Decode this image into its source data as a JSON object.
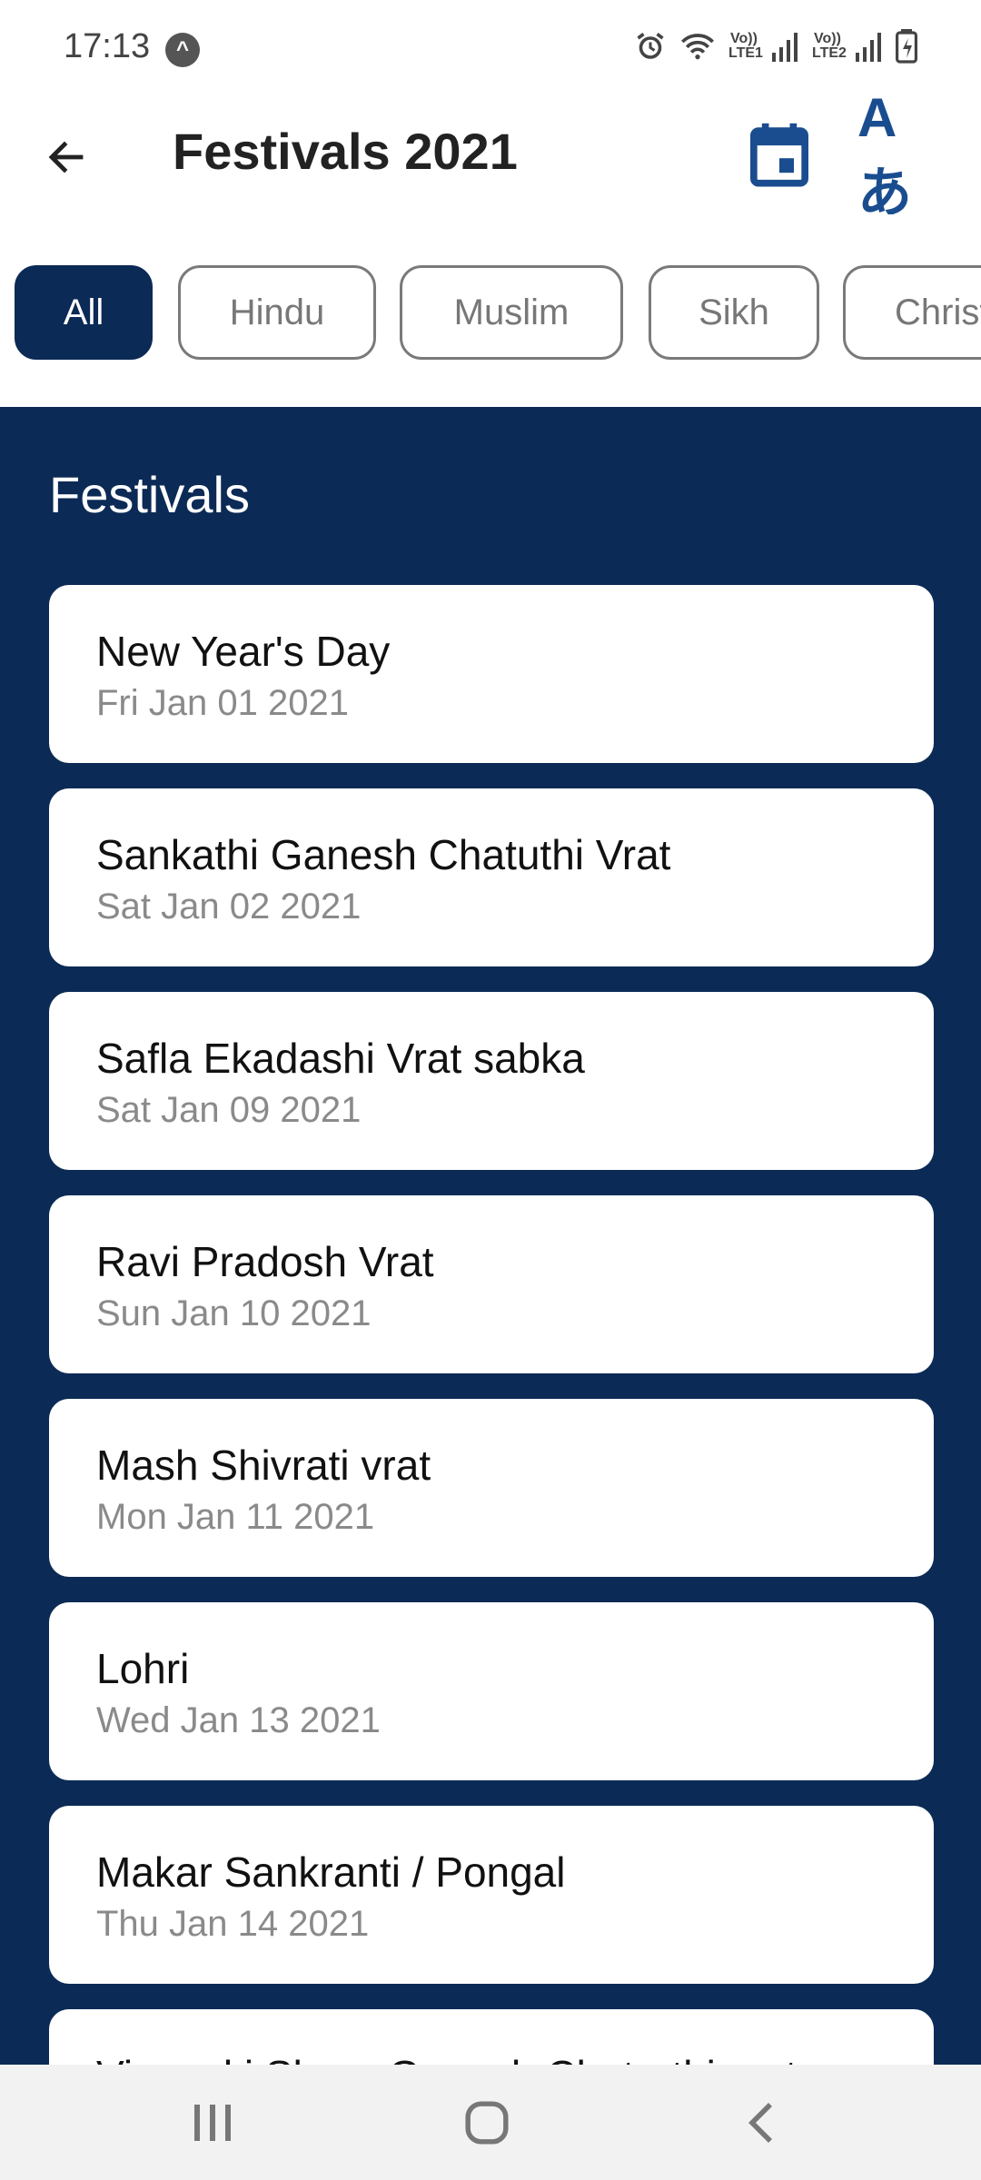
{
  "status_bar": {
    "time": "17:13",
    "alert_glyph": "^",
    "sim1_label": "Vo)) LTE1",
    "sim2_label": "Vo)) LTE2"
  },
  "app_bar": {
    "title": "Festivals 2021",
    "back_icon": "arrow-left-icon",
    "calendar_icon": "calendar-icon",
    "translate_label": "Aあ",
    "accent_color": "#1a4d8f"
  },
  "filters": {
    "items": [
      {
        "label": "All",
        "active": true
      },
      {
        "label": "Hindu",
        "active": false
      },
      {
        "label": "Muslim",
        "active": false
      },
      {
        "label": "Sikh",
        "active": false
      },
      {
        "label": "Christ",
        "active": false
      }
    ],
    "active_color": "#0b2a55"
  },
  "festivals": {
    "section_title": "Festivals",
    "background_color": "#0b2a55",
    "items": [
      {
        "name": "New Year's Day",
        "date": "Fri Jan 01 2021"
      },
      {
        "name": "Sankathi Ganesh Chatuthi Vrat",
        "date": "Sat Jan 02 2021"
      },
      {
        "name": "Safla Ekadashi Vrat sabka",
        "date": "Sat Jan 09 2021"
      },
      {
        "name": "Ravi Pradosh Vrat",
        "date": "Sun Jan 10 2021"
      },
      {
        "name": "Mash Shivrati vrat",
        "date": "Mon Jan 11 2021"
      },
      {
        "name": "Lohri",
        "date": "Wed Jan 13 2021"
      },
      {
        "name": "Makar Sankranti / Pongal",
        "date": "Thu Jan 14 2021"
      },
      {
        "name": "Vinayaki Shree Ganesh Chaturthi vrat",
        "date": ""
      }
    ]
  },
  "nav_bar": {
    "recents_icon": "recents-icon",
    "home_icon": "home-icon",
    "back_icon": "back-chevron-icon"
  }
}
